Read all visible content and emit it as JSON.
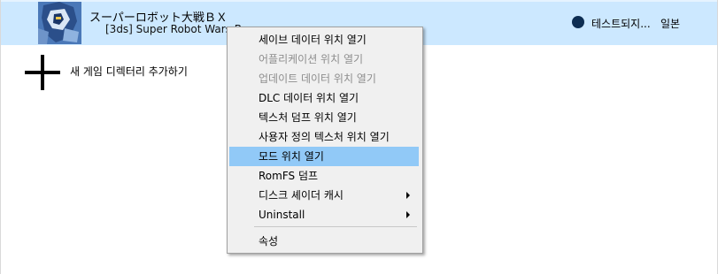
{
  "game": {
    "title": "スーパーロボット大戦ＢＸ",
    "subtitle": "[3ds] Super Robot Wars B",
    "status": "테스트되지...",
    "region": "일본",
    "status_color": "#0d2d52"
  },
  "add_directory": {
    "label": "새 게임 디렉터리 추가하기",
    "icon": "plus-icon"
  },
  "context_menu": {
    "items": [
      {
        "label": "세이브 데이터 위치 열기"
      },
      {
        "label": "어플리케이션 위치 열기",
        "disabled": true
      },
      {
        "label": "업데이트 데이터 위치 열기",
        "disabled": true
      },
      {
        "label": "DLC 데이터 위치 열기"
      },
      {
        "label": "텍스처 덤프 위치 열기"
      },
      {
        "label": "사용자 정의 텍스처 위치 열기"
      },
      {
        "label": "모드 위치 열기",
        "highlighted": true
      },
      {
        "label": "RomFS 덤프"
      },
      {
        "label": "디스크 셰이더 캐시",
        "submenu": true
      },
      {
        "label": "Uninstall",
        "submenu": true
      },
      {
        "label": "속성"
      }
    ]
  },
  "colors": {
    "row_selected": "#cce8ff",
    "menu_highlight": "#91c9f7",
    "menu_bg": "#f0f0f0"
  }
}
